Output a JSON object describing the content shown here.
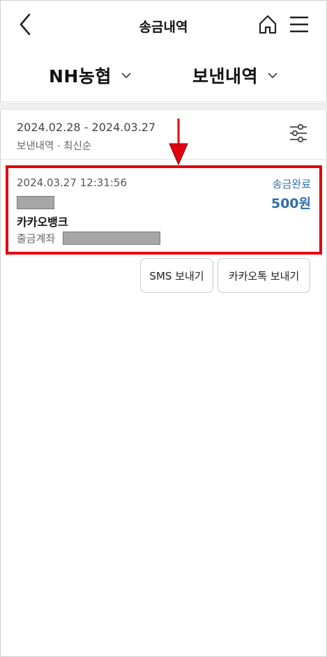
{
  "header": {
    "title": "송금내역",
    "back_icon": "chevron-left-icon",
    "home_icon": "home-icon",
    "menu_icon": "hamburger-menu-icon"
  },
  "selector": {
    "bank": "NH농협",
    "type": "보낸내역"
  },
  "filter": {
    "date_range": "2024.02.28 - 2024.03.27",
    "description": "보낸내역 · 최신순",
    "icon": "sliders-icon"
  },
  "transaction": {
    "time": "2024.03.27 12:31:56",
    "status": "송금완료",
    "amount": "500원",
    "recipient_bank": "카카오뱅크",
    "account_label": "출금계좌"
  },
  "actions": {
    "sms": "SMS 보내기",
    "kakao": "카카오톡 보내기"
  },
  "colors": {
    "accent_blue": "#2f6ea8",
    "highlight_red": "#e3000f"
  }
}
